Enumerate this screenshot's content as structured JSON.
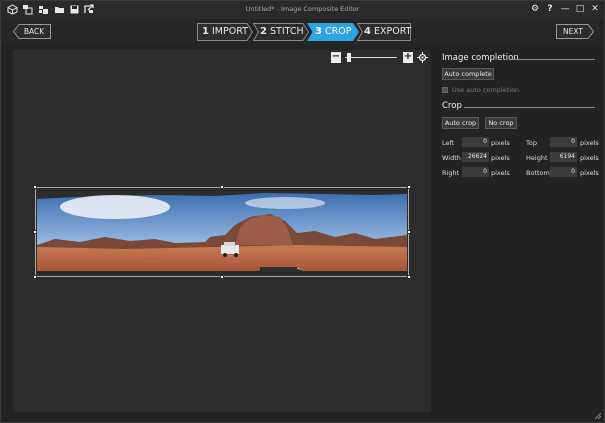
{
  "window": {
    "title": "Untitled* - Image Composite Editor"
  },
  "toolbar": {
    "icons": [
      "new-project-icon",
      "new-panorama-icon",
      "new-stitch-icon",
      "open-icon",
      "save-icon",
      "export-icon"
    ]
  },
  "window_controls": {
    "settings": "⚙",
    "help": "?",
    "minimize": "—",
    "maximize": "□",
    "close": "✕"
  },
  "nav": {
    "back_label": "BACK",
    "next_label": "NEXT",
    "steps": [
      {
        "number": "1",
        "label": "IMPORT",
        "active": false
      },
      {
        "number": "2",
        "label": "STITCH",
        "active": false
      },
      {
        "number": "3",
        "label": "CROP",
        "active": true
      },
      {
        "number": "4",
        "label": "EXPORT",
        "active": false
      }
    ],
    "accent_color": "#2ea3e6"
  },
  "zoom": {
    "minus": "−",
    "plus": "+",
    "level": 0.05
  },
  "panel": {
    "image_completion": {
      "title": "Image completion",
      "auto_complete_label": "Auto complete",
      "use_auto_completion_label": "Use auto completion"
    },
    "crop": {
      "title": "Crop",
      "auto_crop_label": "Auto crop",
      "no_crop_label": "No crop",
      "fields": {
        "left": {
          "label": "Left",
          "value": "0",
          "unit": "pixels"
        },
        "top": {
          "label": "Top",
          "value": "0",
          "unit": "pixels"
        },
        "width": {
          "label": "Width",
          "value": "26624",
          "unit": "pixels"
        },
        "height": {
          "label": "Height",
          "value": "6194",
          "unit": "pixels"
        },
        "right": {
          "label": "Right",
          "value": "0",
          "unit": "pixels"
        },
        "bottom": {
          "label": "Bottom",
          "value": "0",
          "unit": "pixels"
        }
      }
    }
  }
}
